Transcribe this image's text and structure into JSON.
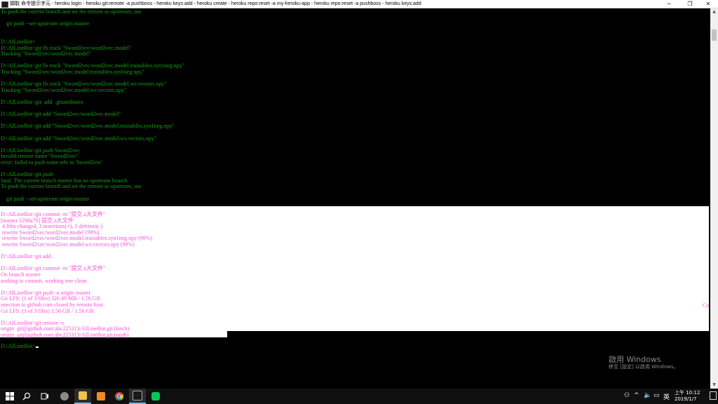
{
  "window": {
    "title": "擷取 命令提示字元 - heroku  login - heroku  git:remote -a pushboss - heroku  keys:add - heroku  create - heroku  repo:reset -a my-heroku-app - heroku  repo:reset -a pushboss - heroku  keys:add",
    "minimize": "─",
    "restore": "❐",
    "close": "✕"
  },
  "console": {
    "lines_top": [
      "To push the current branch and set the remote as upstream, use",
      "",
      "    git push --set-upstream origin master",
      "",
      "",
      "D:\\AILineBot>",
      "D:\\AILineBot>git lfs track \"Sword2vec/word2vec.model\"",
      "Tracking \"Sword2vec/word2vec.model\"",
      "",
      "D:\\AILineBot>git lfs track \"Sword2vec/word2vec.model.trainables.syn1neg.npy\"",
      "Tracking \"Sword2vec/word2vec.model.trainables.syn1neg.npy\"",
      "",
      "D:\\AILineBot>git lfs track \"Sword2vec/word2vec.model.wv.vectors.npy\"",
      "Tracking \"Sword2vec/word2vec.model.wv.vectors.npy\"",
      "",
      "D:\\AILineBot>git  add  .gitattributes",
      "",
      "D:\\AILineBot>git add \"Sword2vec/word2vec.model\"",
      "",
      "D:\\AILineBot>git add \"Sword2vec/word2vec.model.trainables.syn1neg.npy\"",
      "",
      "D:\\AILineBot>git add \"Sword2vec/word2vec.model.wv.vectors.npy\"",
      "",
      "D:\\AILineBot>git push Sword2vec",
      "Invalid remote name \"Sword2vec\"",
      "error: failed to push some refs to 'Sword2vec'",
      "",
      "D:\\AILineBot>git push",
      "fatal: The current branch master has no upstream branch.",
      "To push the current branch and set the remote as upstream, use",
      "",
      "    git push --set-upstream origin master",
      "",
      ""
    ],
    "lines_selected": [
      "D:\\AILineBot>git commit -m \"提交.a大文件\"",
      "[master 129da70] 提交.a大文件",
      " 4 files changed, 3 insertions(+), 1 deletion(-)",
      " rewrite Sword2vec/word2vec.model (99%)",
      " rewrite Sword2vec/word2vec.model.trainables.syn1neg.npy (99%)",
      " rewrite Sword2vec/word2vec.model.wv.vectors.npy (99%)",
      "",
      "D:\\AILineBot>git add .",
      "",
      "D:\\AILineBot>git commit -m \"提交.a大文件\"",
      "On branch master",
      "nothing to commit, working tree clean",
      "",
      "D:\\AILineBot>git push -u origin master",
      "Git LFS: (1 of 3 files) 326.49 MB / 1.56 GB",
      "nnection to github.com closed by remote host.",
      "Git LFS: (3 of 3 files) 1.56 GB / 1.56 GB",
      "",
      "D:\\AILineBot>git remote -v",
      "origin  git@github.com:abc225313/AILineBot.git (fetch)",
      "origin  git@github.com:abc225313/AILineBot.git (push)"
    ],
    "right_fragment": "Co",
    "prompt": "D:\\AILineBot>"
  },
  "watermark": {
    "title": "啟用 Windows",
    "subtitle": "移至 [設定] 以啟用 Windows。"
  },
  "taskbar": {
    "icons": [
      "windows-start-icon",
      "search-icon",
      "task-view-icon",
      "assistant-icon",
      "file-explorer-icon",
      "sublime-text-icon",
      "chrome-icon",
      "command-prompt-icon",
      "line-app-icon"
    ],
    "tray": {
      "ime": "英",
      "time": "上午 10:12",
      "date": "2019/1/7"
    }
  }
}
